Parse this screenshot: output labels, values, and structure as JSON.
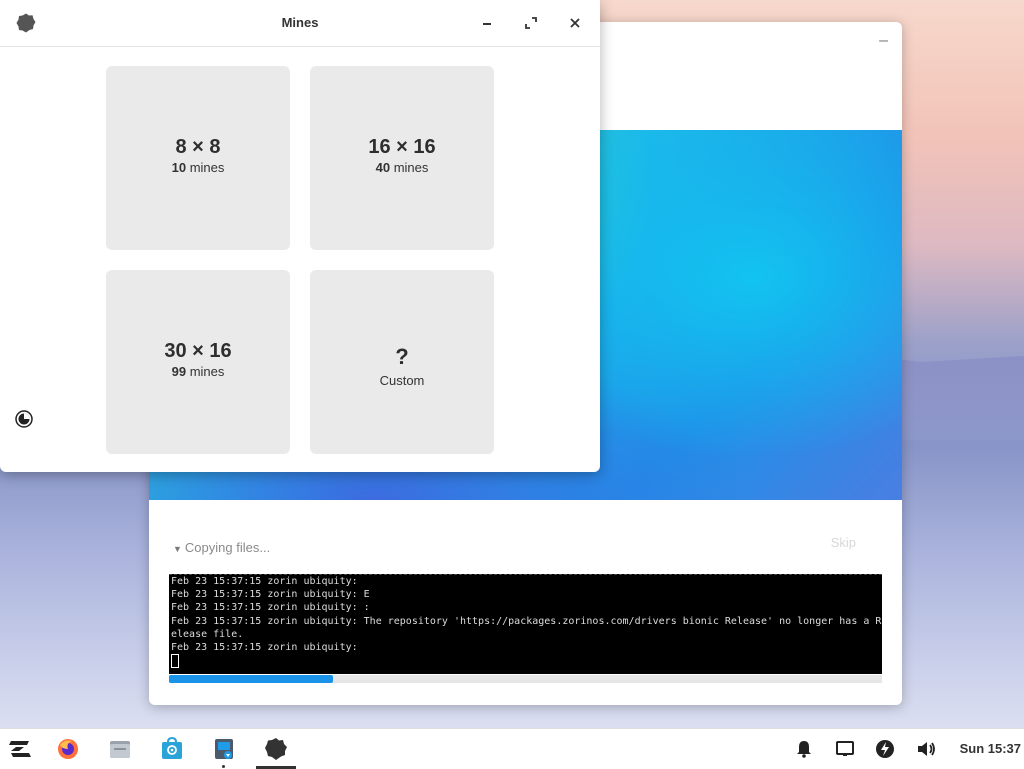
{
  "mines": {
    "title": "Mines",
    "options": [
      {
        "size": "8 × 8",
        "count": "10",
        "unit": "mines"
      },
      {
        "size": "16 × 16",
        "count": "40",
        "unit": "mines"
      },
      {
        "size": "30 × 16",
        "count": "99",
        "unit": "mines"
      }
    ],
    "custom": {
      "symbol": "?",
      "label": "Custom"
    }
  },
  "installer": {
    "status": "Copying files...",
    "skip_label": "Skip",
    "progress_fraction": 0.23,
    "terminal_lines": [
      "Feb 23 15:37:15 zorin ubiquity:",
      "Feb 23 15:37:15 zorin ubiquity: E",
      "Feb 23 15:37:15 zorin ubiquity: :",
      "Feb 23 15:37:15 zorin ubiquity: The repository 'https://packages.zorinos.com/drivers bionic Release' no longer has a R",
      "elease file.",
      "Feb 23 15:37:15 zorin ubiquity:"
    ]
  },
  "taskbar": {
    "clock": "Sun 15:37",
    "apps": [
      "zorin-menu-icon",
      "firefox-icon",
      "files-icon",
      "software-store-icon",
      "installer-icon",
      "mines-icon"
    ],
    "tray": [
      "notification-bell-icon",
      "display-icon",
      "power-icon",
      "volume-icon"
    ]
  },
  "colors": {
    "accent": "#1a93e8",
    "card_bg": "#eaeaea"
  }
}
